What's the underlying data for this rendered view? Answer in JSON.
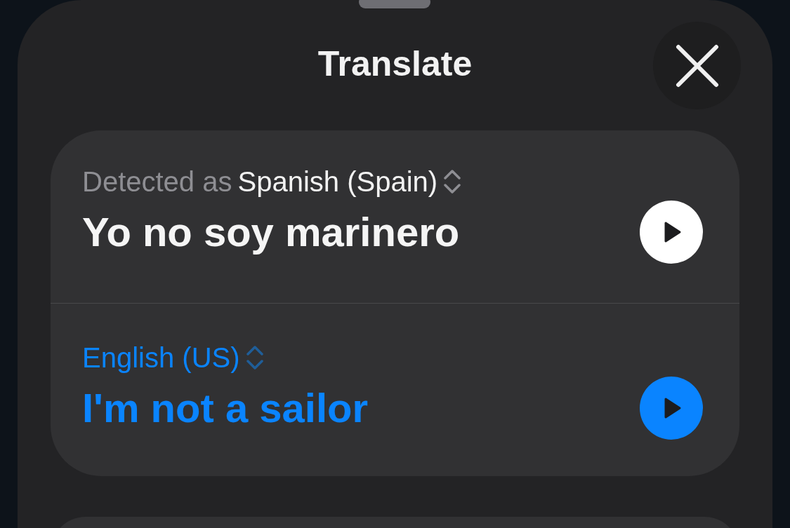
{
  "sheet": {
    "title": "Translate"
  },
  "translations": [
    {
      "kind": "source",
      "prefix": "Detected as",
      "language": "Spanish (Spain)",
      "text": "Yo no soy marinero"
    },
    {
      "kind": "target",
      "language": "English (US)",
      "text": "I'm not a sailor"
    }
  ]
}
